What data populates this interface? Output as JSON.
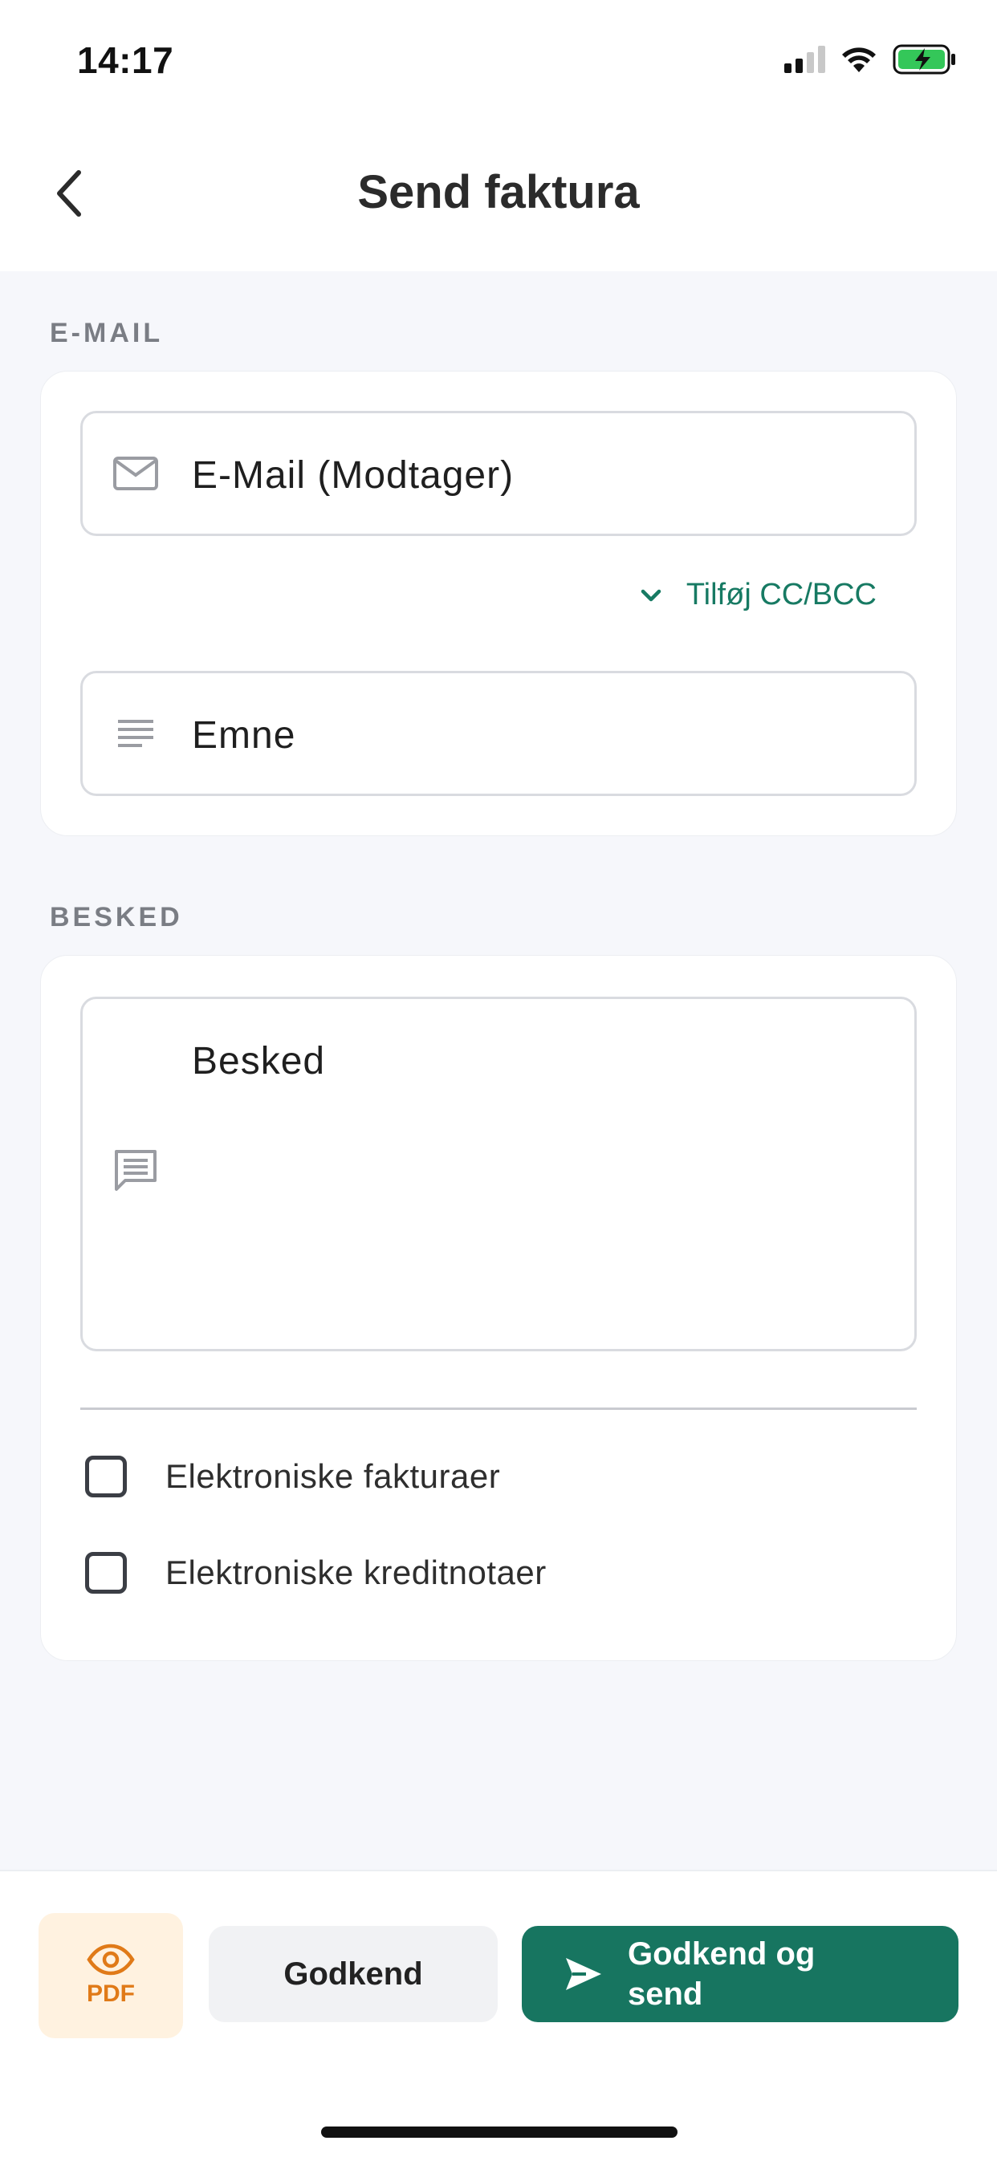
{
  "status_bar": {
    "time": "14:17"
  },
  "header": {
    "title": "Send faktura"
  },
  "sections": {
    "email_label": "E-MAIL",
    "message_label": "BESKED"
  },
  "email": {
    "recipient_placeholder": "E-Mail (Modtager)",
    "cc_bcc_link": "Tilføj CC/BCC",
    "subject_placeholder": "Emne"
  },
  "message": {
    "body_placeholder": "Besked"
  },
  "options": [
    {
      "label": "Elektroniske fakturaer",
      "checked": false
    },
    {
      "label": "Elektroniske kreditnotaer",
      "checked": false
    }
  ],
  "actions": {
    "pdf_label": "PDF",
    "approve_label": "Godkend",
    "approve_send_label": "Godkend og send"
  },
  "colors": {
    "accent": "#177560",
    "pdf_accent": "#e07a18",
    "background": "#f6f7fb"
  }
}
